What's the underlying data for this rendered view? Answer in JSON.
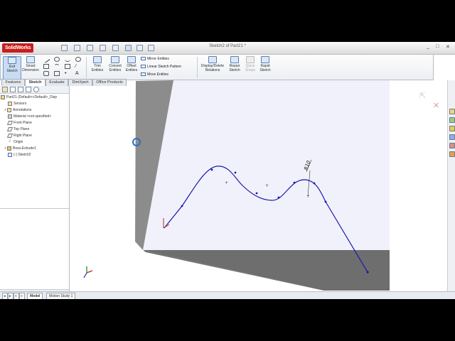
{
  "app": {
    "logo_text": "SolidWorks",
    "doc_title": "Sketch2 of Part21 *",
    "window_controls": [
      "_",
      "□",
      "✕"
    ]
  },
  "ribbon": {
    "exit_sketch": "Exit Sketch",
    "smart_dimension": "Smart Dimension",
    "trim_entities": "Trim Entities",
    "convert_entities": "Convert Entities",
    "offset_entities": "Offset Entities",
    "mirror_entities": "Mirror Entities",
    "linear_sketch_pattern": "Linear Sketch Pattern",
    "move_entities": "Move Entities",
    "display_delete_relations": "Display/Delete Relations",
    "repair_sketch": "Repair Sketch",
    "quick_snaps": "Quick Snaps",
    "rapid_sketch": "Rapid Sketch"
  },
  "tabs": [
    "Features",
    "Sketch",
    "Evaluate",
    "DimXpert",
    "Office Products"
  ],
  "active_tab": "Sketch",
  "tree": {
    "root": "Part21 (Default<<Default>_Disp",
    "items": [
      {
        "label": "Sensors",
        "level": 1
      },
      {
        "label": "Annotations",
        "level": 1
      },
      {
        "label": "Material <not specified>",
        "level": 1
      },
      {
        "label": "Front Plane",
        "level": 1
      },
      {
        "label": "Top Plane",
        "level": 1
      },
      {
        "label": "Right Plane",
        "level": 1
      },
      {
        "label": "Origin",
        "level": 1
      },
      {
        "label": "Boss-Extrude1",
        "level": 1
      },
      {
        "label": "(-) Sketch2",
        "level": 1
      }
    ]
  },
  "bottom_tabs": [
    "Model",
    "Motion Study 1"
  ],
  "sketch": {
    "dimension_label": "R10"
  },
  "colors": {
    "sketch_line": "#1a1aa8",
    "face_top": "#f1f1fb",
    "face_side": "#8c8c8c",
    "face_bottom": "#6e6e6e"
  }
}
